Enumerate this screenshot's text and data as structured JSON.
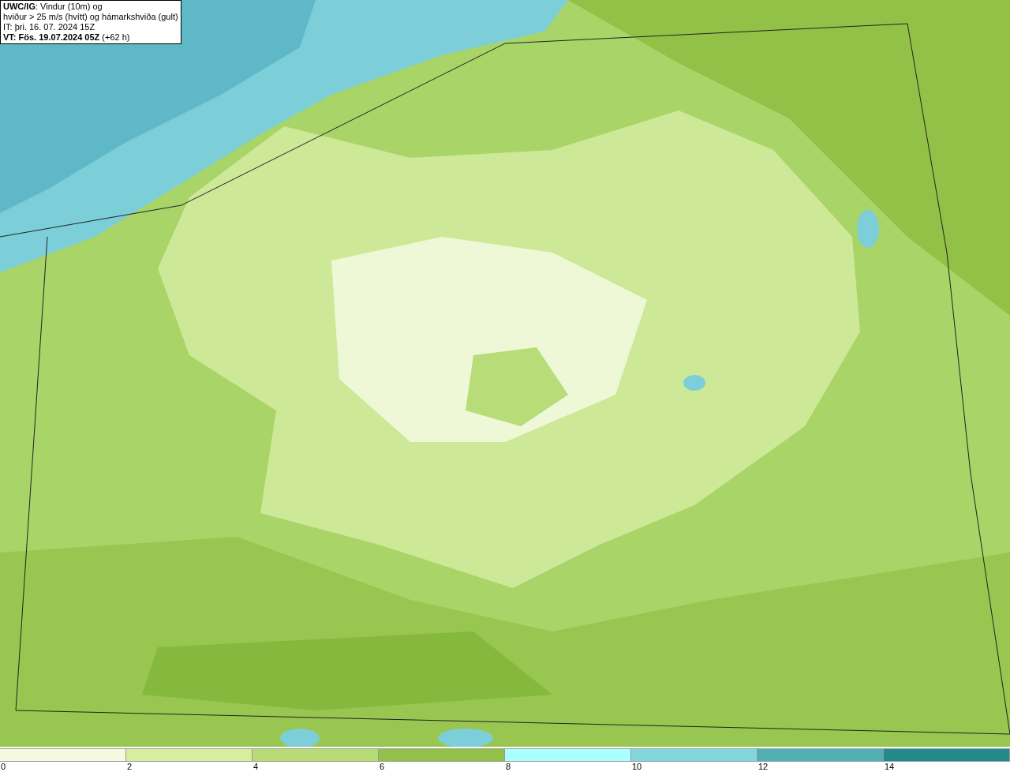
{
  "info_box": {
    "lines": [
      "**UWC/IG**: Vindur (10m) og",
      "hviður > 25 m/s (hvítt) og hámarkshviða (gult)",
      "IT: þri. 16. 07. 2024 15Z",
      "**VT: Fös. 19.07.2024 05Z** (+62 h)"
    ]
  },
  "legend": {
    "segments": [
      {
        "color": "#f3fadf",
        "label": "0"
      },
      {
        "color": "#d6ee9e",
        "label": "2"
      },
      {
        "color": "#b7dc76",
        "label": "4"
      },
      {
        "color": "#93c046",
        "label": "6"
      },
      {
        "color": "#aaffff",
        "label": "8"
      },
      {
        "color": "#80d8dc",
        "label": "10"
      },
      {
        "color": "#50b0b4",
        "label": "12"
      },
      {
        "color": "#218a8a",
        "label": "14"
      }
    ]
  }
}
